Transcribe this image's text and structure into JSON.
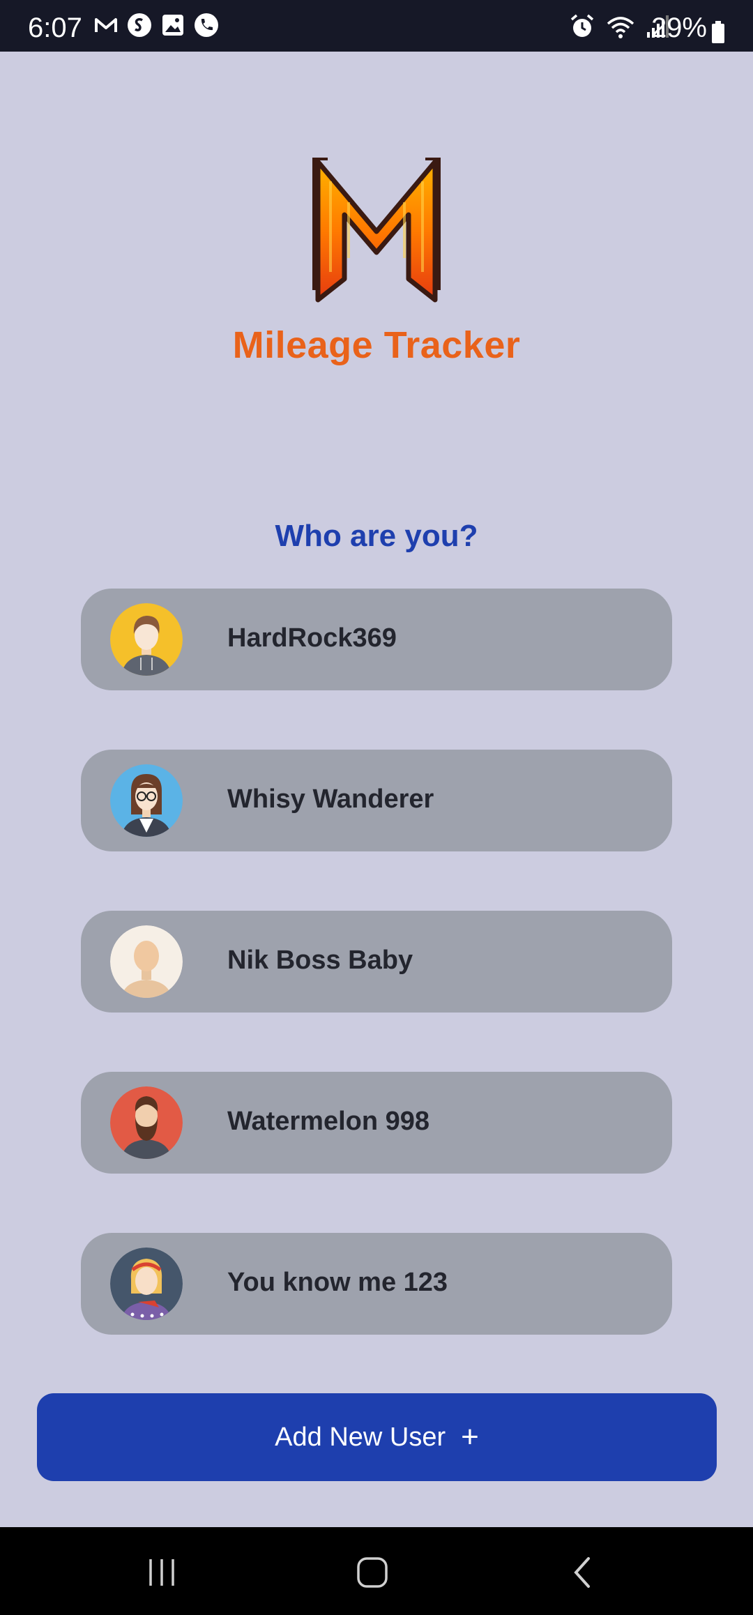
{
  "status_bar": {
    "time": "6:07",
    "battery_percent": "29%",
    "left_icons": [
      "gmail-icon",
      "shazam-icon",
      "gallery-icon",
      "phone-icon"
    ],
    "right_icons": [
      "alarm-icon",
      "wifi-icon",
      "signal-icon",
      "battery-icon"
    ]
  },
  "app": {
    "title": "Mileage Tracker",
    "prompt": "Who are you?"
  },
  "users": [
    {
      "name": "HardRock369",
      "avatar": "avatar-man-yellow"
    },
    {
      "name": "Whisy Wanderer",
      "avatar": "avatar-woman-glasses"
    },
    {
      "name": "Nik Boss Baby",
      "avatar": "avatar-blank"
    },
    {
      "name": "Watermelon 998",
      "avatar": "avatar-bearded-man"
    },
    {
      "name": "You know me 123",
      "avatar": "avatar-woman-headband"
    }
  ],
  "add_button": {
    "label": "Add New User",
    "icon": "plus-icon"
  },
  "nav": [
    "recent-apps-icon",
    "home-icon",
    "back-icon"
  ],
  "colors": {
    "background": "#cccce0",
    "title_orange": "#e9621a",
    "accent_blue": "#1e3fae",
    "card_gray": "#9ea2ad"
  }
}
